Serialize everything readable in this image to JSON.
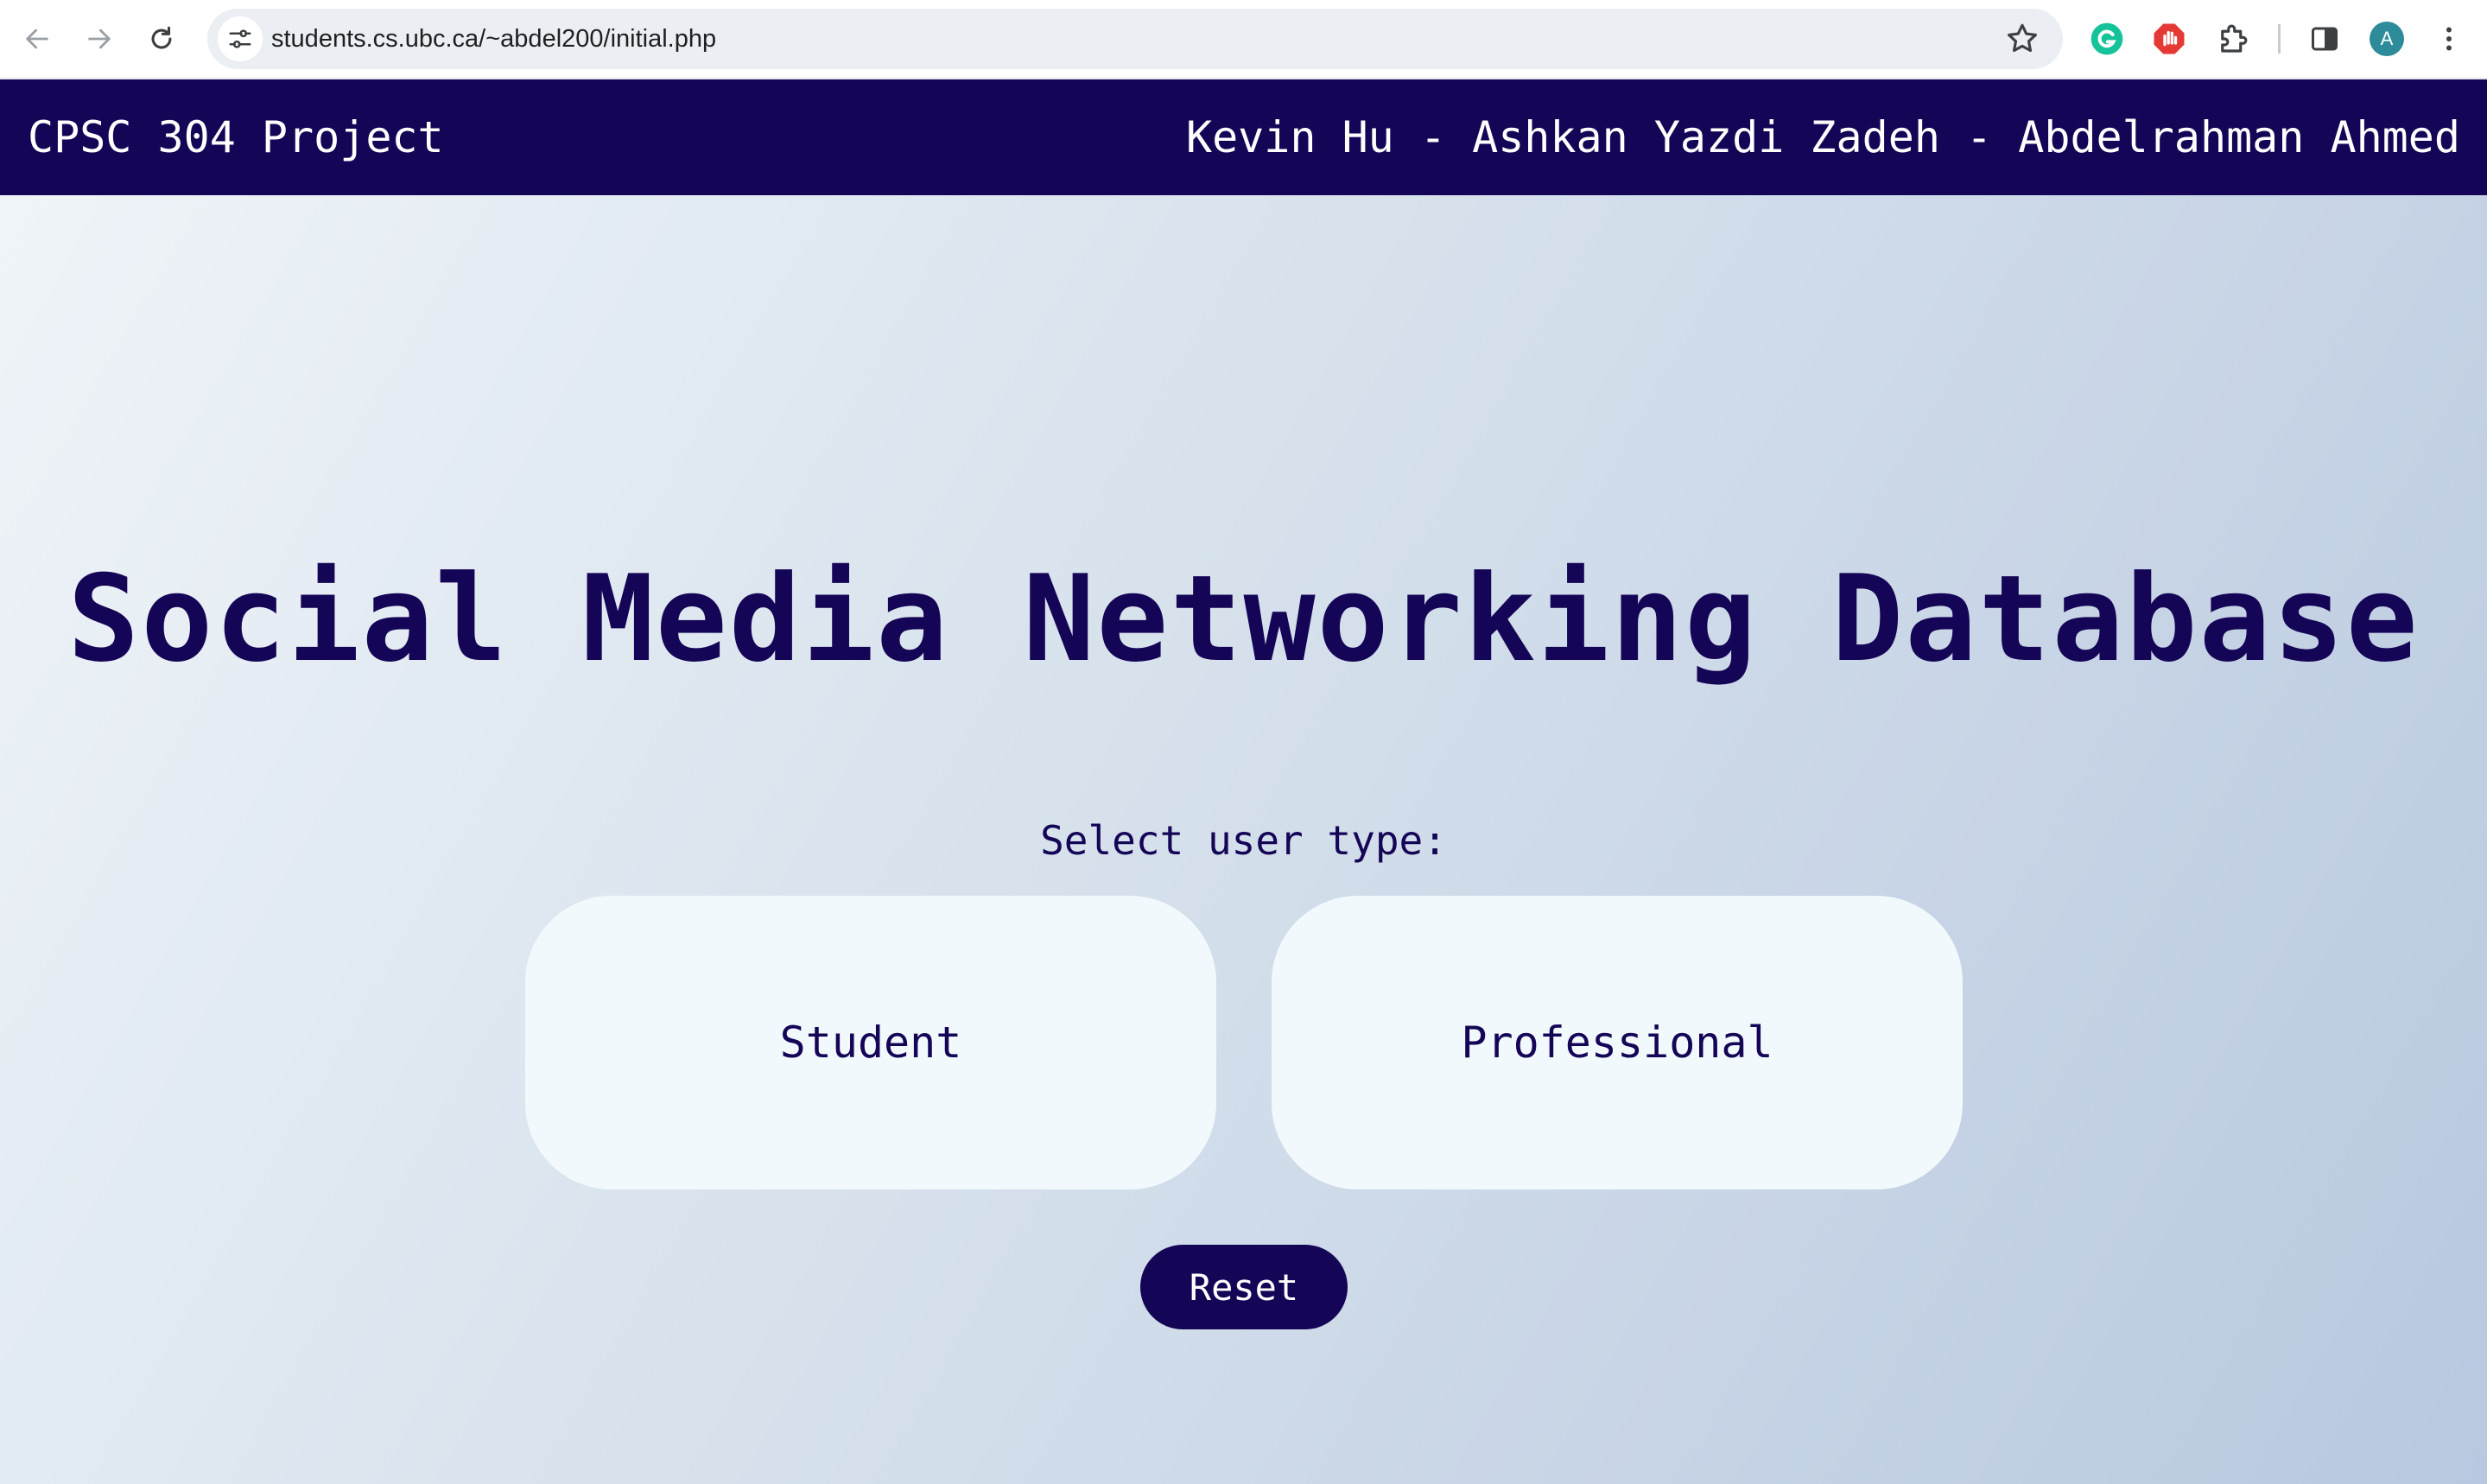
{
  "browser": {
    "url": "students.cs.ubc.ca/~abdel200/initial.php",
    "profile_initial": "A",
    "icons": {
      "back": "back-arrow-icon",
      "forward": "forward-arrow-icon",
      "reload": "reload-icon",
      "site_info": "tune-icon",
      "bookmark": "star-icon",
      "grammarly": "grammarly-icon",
      "adblock": "stop-hand-icon",
      "extensions": "puzzle-icon",
      "side_panel": "side-panel-icon",
      "menu": "kebab-menu-icon"
    },
    "colors": {
      "grammarly": "#15c39a",
      "adblock": "#e53935",
      "profile": "#2e8b9a"
    }
  },
  "header": {
    "title": "CPSC 304 Project",
    "authors": "Kevin Hu - Ashkan Yazdi Zadeh - Abdelrahman Ahmed"
  },
  "main": {
    "heading": "Social Media Networking Database",
    "prompt": "Select user type:",
    "options": [
      {
        "label": "Student"
      },
      {
        "label": "Professional"
      }
    ],
    "reset_label": "Reset"
  },
  "colors": {
    "primary": "#150556",
    "card": "#f2f9fd",
    "background_start": "#eff4f8",
    "background_end": "#b9c8e0"
  }
}
